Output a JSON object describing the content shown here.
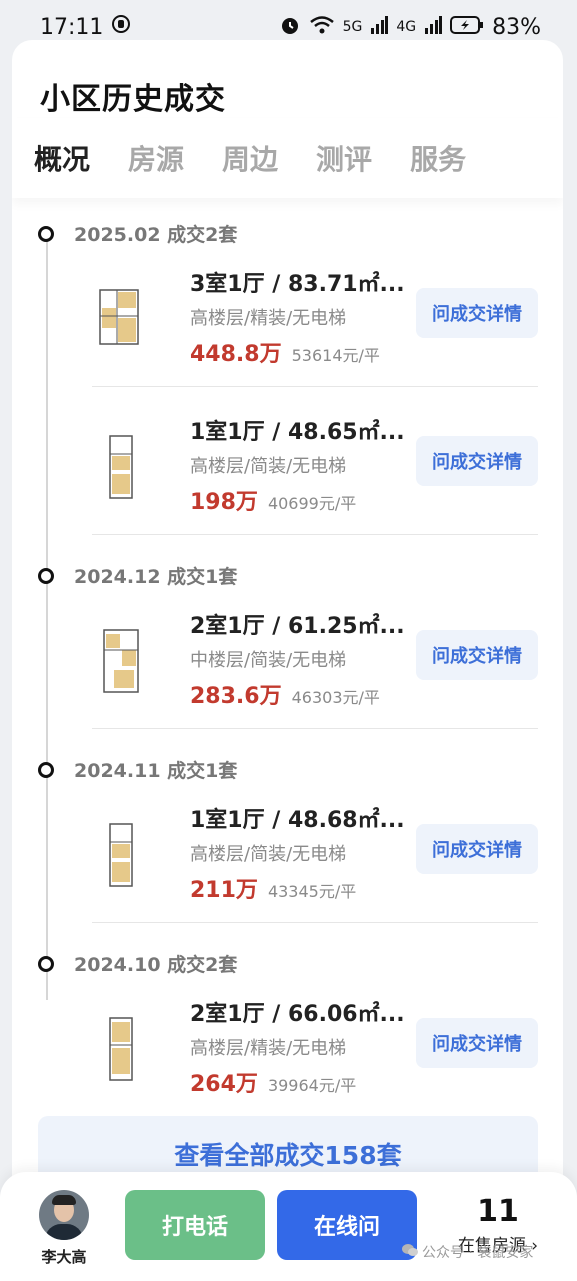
{
  "status_bar": {
    "time": "17:11",
    "battery": "83%",
    "signal_1": "5G",
    "signal_2": "4G"
  },
  "page": {
    "title": "小区历史成交",
    "tabs": [
      "概况",
      "房源",
      "周边",
      "测评",
      "服务"
    ],
    "active_tab": 0
  },
  "groups": [
    {
      "label": "2025.02 成交2套"
    },
    {
      "label": "2024.12 成交1套"
    },
    {
      "label": "2024.11 成交1套"
    },
    {
      "label": "2024.10 成交2套"
    }
  ],
  "deals": [
    {
      "layout": "3室1厅 / 83.71㎡...",
      "attrs": "高楼层/精装/无电梯",
      "total": "448.8万",
      "unit_price": "53614元/平",
      "ask": "问成交详情"
    },
    {
      "layout": "1室1厅 / 48.65㎡...",
      "attrs": "高楼层/简装/无电梯",
      "total": "198万",
      "unit_price": "40699元/平",
      "ask": "问成交详情"
    },
    {
      "layout": "2室1厅 / 61.25㎡...",
      "attrs": "中楼层/简装/无电梯",
      "total": "283.6万",
      "unit_price": "46303元/平",
      "ask": "问成交详情"
    },
    {
      "layout": "1室1厅 / 48.68㎡...",
      "attrs": "高楼层/简装/无电梯",
      "total": "211万",
      "unit_price": "43345元/平",
      "ask": "问成交详情"
    },
    {
      "layout": "2室1厅 / 66.06㎡...",
      "attrs": "高楼层/精装/无电梯",
      "total": "264万",
      "unit_price": "39964元/平",
      "ask": "问成交详情"
    }
  ],
  "view_all": "查看全部成交158套",
  "bottom": {
    "agent_name": "李大高",
    "call": "打电话",
    "online": "在线问",
    "onsale_count": "11",
    "onsale_label": "在售房源 ›"
  },
  "watermark": "公众号 · 袋鼠安家",
  "colors": {
    "accent_blue": "#3369e8",
    "call_green": "#6bbf88",
    "price_red": "#c23a2e"
  }
}
